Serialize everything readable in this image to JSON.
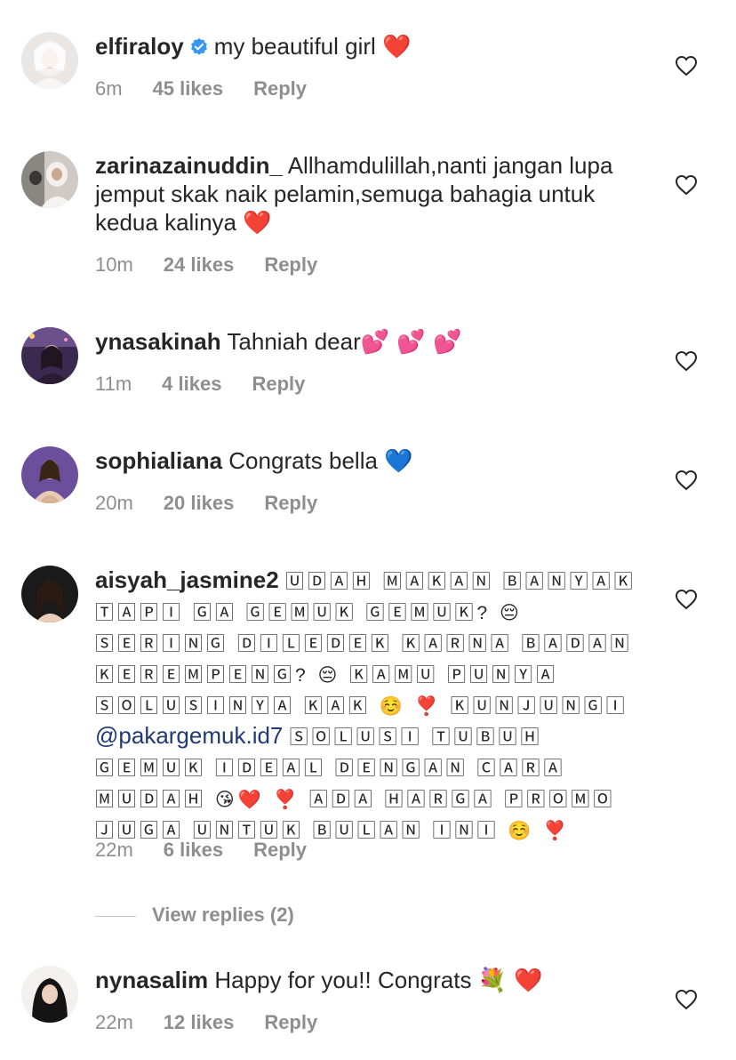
{
  "colors": {
    "text": "#262626",
    "muted": "#8e8e8e",
    "mention": "#1f3a75",
    "verified": "#3897f0"
  },
  "comments": [
    {
      "username": "elfiraloy",
      "verified": true,
      "text": "my beautiful girl",
      "emoji": "❤️",
      "time": "6m",
      "likes": "45 likes",
      "reply": "Reply"
    },
    {
      "username": "zarinazainuddin_",
      "verified": false,
      "text": "Allhamdulillah,nanti jangan lupa jemput skak naik pelamin,semuga bahagia untuk kedua kalinya",
      "emoji": "❤️",
      "time": "10m",
      "likes": "24 likes",
      "reply": "Reply"
    },
    {
      "username": "ynasakinah",
      "verified": false,
      "text": "Tahniah dear",
      "emoji": "💕 💕 💕",
      "time": "11m",
      "likes": "4 likes",
      "reply": "Reply"
    },
    {
      "username": "sophialiana",
      "verified": false,
      "text": "Congrats bella",
      "emoji": "💙",
      "time": "20m",
      "likes": "20 likes",
      "reply": "Reply"
    },
    {
      "username": "aisyah_jasmine2",
      "verified": false,
      "text_part1": "🅄🄳🄰🄷 🄼🄰🄺🄰🄽 🄱🄰🄽🅈🄰🄺 🅃🄰🄿🄸 🄶🄰 🄶🄴🄼🅄🄺 🄶🄴🄼🅄🄺? 😔 🅂🄴🅁🄸🄽🄶 🄳🄸🄻🄴🄳🄴🄺 🄺🄰🅁🄽🄰 🄱🄰🄳🄰🄽 🄺🄴🅁🄴🄼🄿🄴🄽🄶? 😔 🄺🄰🄼🅄 🄿🅄🄽🅈🄰 🅂🄾🄻🅄🅂🄸🄽🅈🄰 🄺🄰🄺 ☺️ ❣️ 🄺🅄🄽🄹🅄🄽🄶🄸",
      "mention": "@pakargemuk.id7",
      "text_part2": "🅂🄾🄻🅄🅂🄸 🅃🅄🄱🅄🄷 🄶🄴🄼🅄🄺 🄸🄳🄴🄰🄻 🄳🄴🄽🄶🄰🄽 🄲🄰🅁🄰 🄼🅄🄳🄰🄷 😘❤️ ❣️ 🄰🄳🄰 🄷🄰🅁🄶🄰 🄿🅁🄾🄼🄾 🄹🅄🄶🄰 🅄🄽🅃🅄🄺 🄱🅄🄻🄰🄽 🄸🄽🄸 ☺️ ❣️",
      "time": "22m",
      "likes": "6 likes",
      "reply": "Reply"
    },
    {
      "username": "nynasalim",
      "verified": false,
      "text": "Happy for you!! Congrats",
      "emoji": "💐 ❤️",
      "time": "22m",
      "likes": "12 likes",
      "reply": "Reply"
    }
  ],
  "view_replies": "View replies (2)"
}
